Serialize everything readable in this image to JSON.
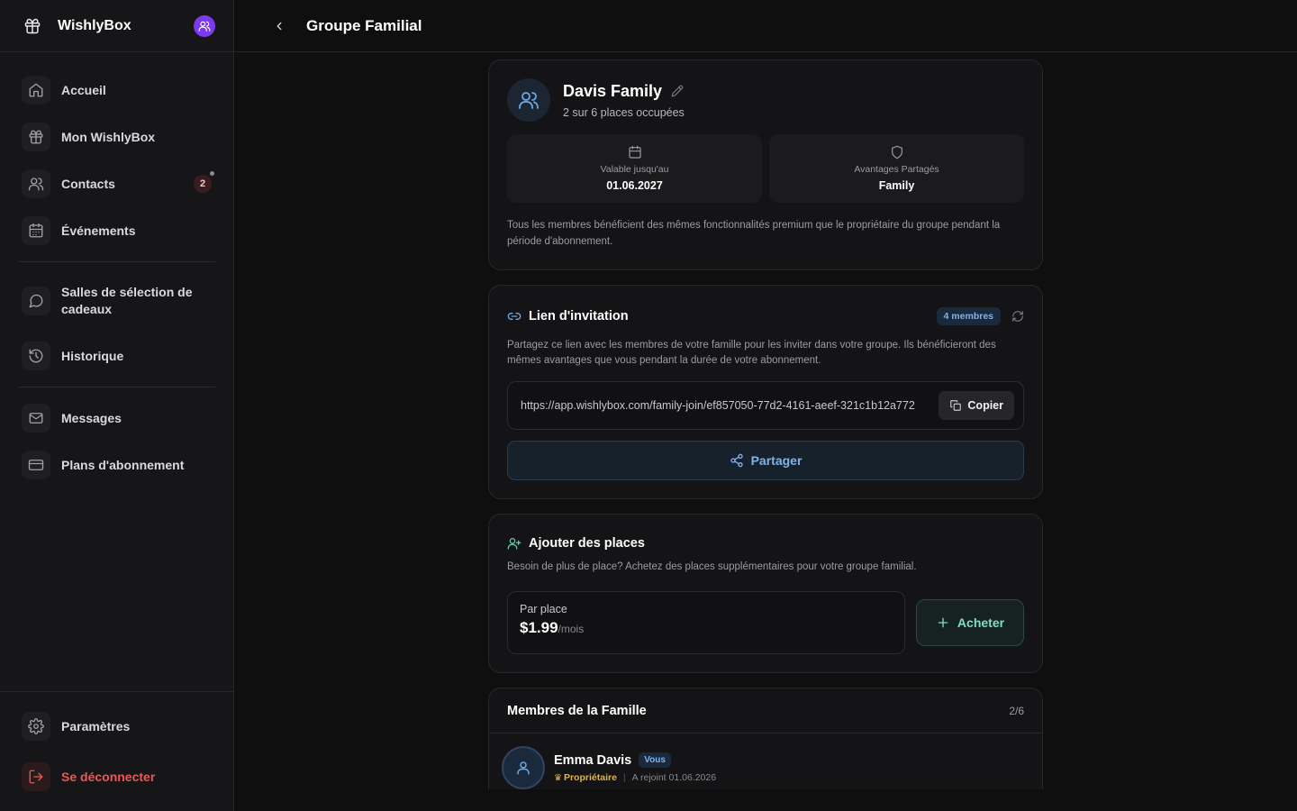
{
  "app": {
    "name": "WishlyBox"
  },
  "sidebar": {
    "items": [
      {
        "label": "Accueil",
        "icon": "home-icon"
      },
      {
        "label": "Mon WishlyBox",
        "icon": "gift-icon"
      },
      {
        "label": "Contacts",
        "icon": "users-icon",
        "badge": "2"
      },
      {
        "label": "Événements",
        "icon": "calendar-icon"
      },
      {
        "label": "Salles de sélection de cadeaux",
        "icon": "chat-icon"
      },
      {
        "label": "Historique",
        "icon": "history-icon"
      },
      {
        "label": "Messages",
        "icon": "mail-icon"
      },
      {
        "label": "Plans d'abonnement",
        "icon": "credit-card-icon"
      }
    ],
    "footer": [
      {
        "label": "Paramètres",
        "icon": "gear-icon"
      },
      {
        "label": "Se déconnecter",
        "icon": "logout-icon"
      }
    ]
  },
  "header": {
    "title": "Groupe Familial"
  },
  "group": {
    "name": "Davis Family",
    "occupancy": "2 sur 6 places occupées",
    "valid_label": "Valable jusqu'au",
    "valid_value": "01.06.2027",
    "benefits_label": "Avantages Partagés",
    "benefits_value": "Family",
    "note": "Tous les membres bénéficient des mêmes fonctionnalités premium que le propriétaire du groupe pendant la période d'abonnement."
  },
  "invite": {
    "title": "Lien d'invitation",
    "members_badge": "4 membres",
    "description": "Partagez ce lien avec les membres de votre famille pour les inviter dans votre groupe. Ils bénéficieront des mêmes avantages que vous pendant la durée de votre abonnement.",
    "link": "https://app.wishlybox.com/family-join/ef857050-77d2-4161-aeef-321c1b12a772",
    "copy_label": "Copier",
    "share_label": "Partager"
  },
  "seats": {
    "title": "Ajouter des places",
    "description": "Besoin de plus de place? Achetez des places supplémentaires pour votre groupe familial.",
    "per_seat_label": "Par place",
    "price": "$1.99",
    "unit": "/mois",
    "buy_label": "Acheter"
  },
  "members": {
    "title": "Membres de la Famille",
    "count": "2/6",
    "list": [
      {
        "name": "Emma Davis",
        "badge": "Vous",
        "role": "Propriétaire",
        "joined": "A rejoint 01.06.2026"
      }
    ]
  },
  "colors": {
    "accent_blue": "#7eb3ee",
    "accent_green": "#7de0c0",
    "danger": "#e45a5a",
    "owner_gold": "#e6b43c",
    "brand_avatar": "#7c3aed"
  }
}
